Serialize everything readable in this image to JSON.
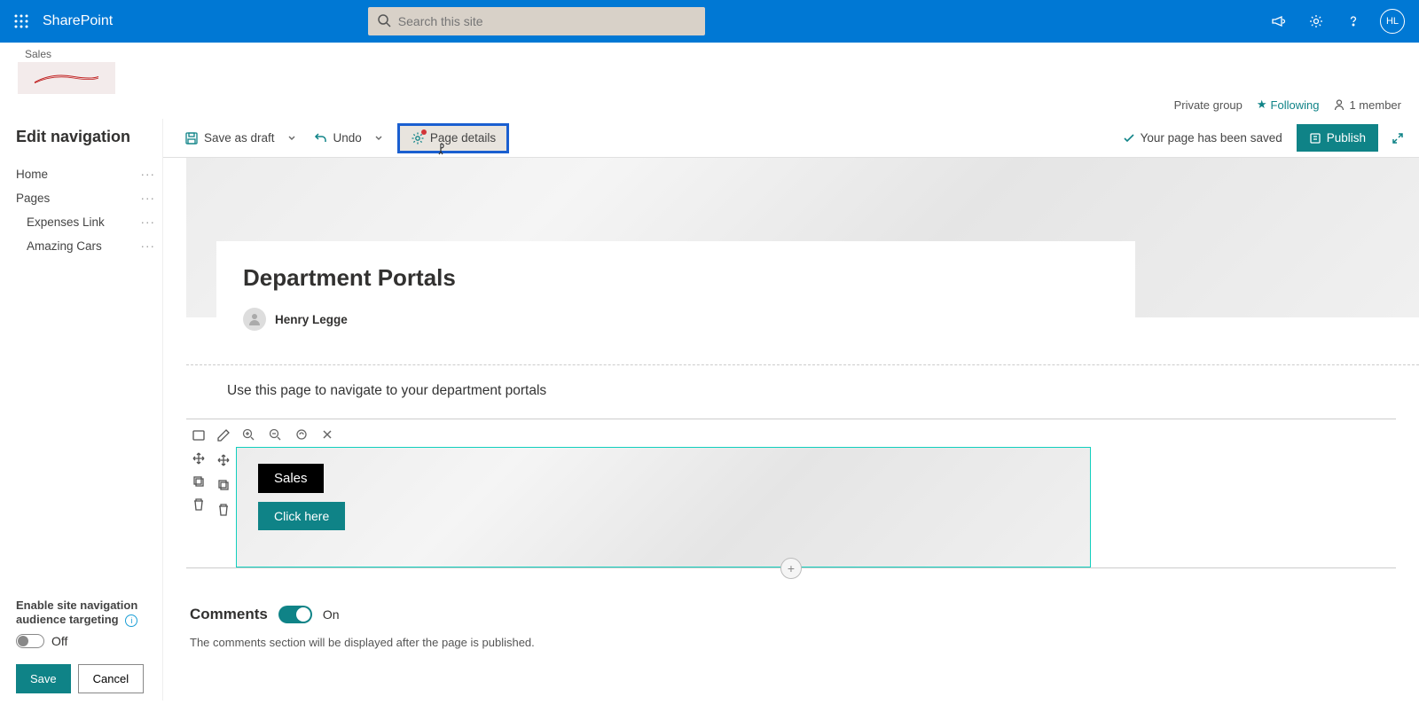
{
  "suite": {
    "app_name": "SharePoint",
    "search_placeholder": "Search this site",
    "avatar_initials": "HL"
  },
  "site": {
    "name": "Sales",
    "privacy": "Private group",
    "following_label": "Following",
    "members_label": "1 member"
  },
  "left_nav": {
    "title": "Edit navigation",
    "items": [
      "Home",
      "Pages"
    ],
    "sub_items": [
      "Expenses Link",
      "Amazing Cars"
    ],
    "audience_label": "Enable site navigation audience targeting",
    "toggle_label": "Off",
    "save": "Save",
    "cancel": "Cancel"
  },
  "cmd": {
    "save_draft": "Save as draft",
    "undo": "Undo",
    "page_details": "Page details",
    "saved_msg": "Your page has been saved",
    "publish": "Publish"
  },
  "page": {
    "title": "Department Portals",
    "author": "Henry Legge",
    "description": "Use this page to navigate to your department portals",
    "webpart": {
      "label": "Sales",
      "button": "Click here"
    },
    "comments_heading": "Comments",
    "comments_toggle": "On",
    "comments_note": "The comments section will be displayed after the page is published."
  }
}
